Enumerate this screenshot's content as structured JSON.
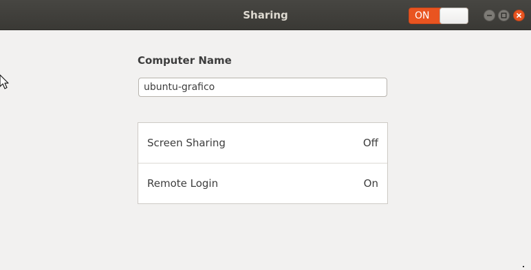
{
  "window": {
    "title": "Sharing"
  },
  "header": {
    "sharing_switch": {
      "label": "ON",
      "state": "on",
      "accent_color": "#e95420"
    },
    "controls": {
      "minimize_icon": "minimize-icon",
      "maximize_icon": "maximize-icon",
      "close_icon": "close-icon"
    }
  },
  "main": {
    "computer_name_label": "Computer Name",
    "computer_name_value": "ubuntu-grafico",
    "services": [
      {
        "label": "Screen Sharing",
        "status": "Off"
      },
      {
        "label": "Remote Login",
        "status": "On"
      }
    ]
  }
}
